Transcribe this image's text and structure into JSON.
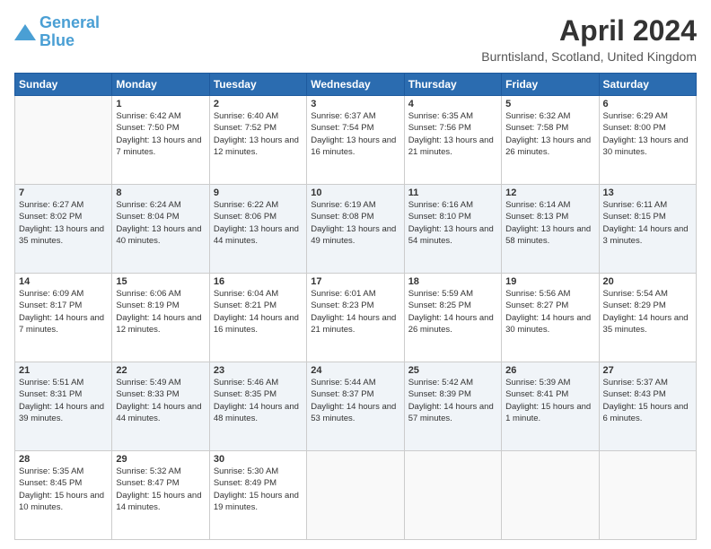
{
  "header": {
    "logo_line1": "General",
    "logo_line2": "Blue",
    "title": "April 2024",
    "subtitle": "Burntisland, Scotland, United Kingdom"
  },
  "days_of_week": [
    "Sunday",
    "Monday",
    "Tuesday",
    "Wednesday",
    "Thursday",
    "Friday",
    "Saturday"
  ],
  "weeks": [
    [
      {
        "num": "",
        "sunrise": "",
        "sunset": "",
        "daylight": ""
      },
      {
        "num": "1",
        "sunrise": "Sunrise: 6:42 AM",
        "sunset": "Sunset: 7:50 PM",
        "daylight": "Daylight: 13 hours and 7 minutes."
      },
      {
        "num": "2",
        "sunrise": "Sunrise: 6:40 AM",
        "sunset": "Sunset: 7:52 PM",
        "daylight": "Daylight: 13 hours and 12 minutes."
      },
      {
        "num": "3",
        "sunrise": "Sunrise: 6:37 AM",
        "sunset": "Sunset: 7:54 PM",
        "daylight": "Daylight: 13 hours and 16 minutes."
      },
      {
        "num": "4",
        "sunrise": "Sunrise: 6:35 AM",
        "sunset": "Sunset: 7:56 PM",
        "daylight": "Daylight: 13 hours and 21 minutes."
      },
      {
        "num": "5",
        "sunrise": "Sunrise: 6:32 AM",
        "sunset": "Sunset: 7:58 PM",
        "daylight": "Daylight: 13 hours and 26 minutes."
      },
      {
        "num": "6",
        "sunrise": "Sunrise: 6:29 AM",
        "sunset": "Sunset: 8:00 PM",
        "daylight": "Daylight: 13 hours and 30 minutes."
      }
    ],
    [
      {
        "num": "7",
        "sunrise": "Sunrise: 6:27 AM",
        "sunset": "Sunset: 8:02 PM",
        "daylight": "Daylight: 13 hours and 35 minutes."
      },
      {
        "num": "8",
        "sunrise": "Sunrise: 6:24 AM",
        "sunset": "Sunset: 8:04 PM",
        "daylight": "Daylight: 13 hours and 40 minutes."
      },
      {
        "num": "9",
        "sunrise": "Sunrise: 6:22 AM",
        "sunset": "Sunset: 8:06 PM",
        "daylight": "Daylight: 13 hours and 44 minutes."
      },
      {
        "num": "10",
        "sunrise": "Sunrise: 6:19 AM",
        "sunset": "Sunset: 8:08 PM",
        "daylight": "Daylight: 13 hours and 49 minutes."
      },
      {
        "num": "11",
        "sunrise": "Sunrise: 6:16 AM",
        "sunset": "Sunset: 8:10 PM",
        "daylight": "Daylight: 13 hours and 54 minutes."
      },
      {
        "num": "12",
        "sunrise": "Sunrise: 6:14 AM",
        "sunset": "Sunset: 8:13 PM",
        "daylight": "Daylight: 13 hours and 58 minutes."
      },
      {
        "num": "13",
        "sunrise": "Sunrise: 6:11 AM",
        "sunset": "Sunset: 8:15 PM",
        "daylight": "Daylight: 14 hours and 3 minutes."
      }
    ],
    [
      {
        "num": "14",
        "sunrise": "Sunrise: 6:09 AM",
        "sunset": "Sunset: 8:17 PM",
        "daylight": "Daylight: 14 hours and 7 minutes."
      },
      {
        "num": "15",
        "sunrise": "Sunrise: 6:06 AM",
        "sunset": "Sunset: 8:19 PM",
        "daylight": "Daylight: 14 hours and 12 minutes."
      },
      {
        "num": "16",
        "sunrise": "Sunrise: 6:04 AM",
        "sunset": "Sunset: 8:21 PM",
        "daylight": "Daylight: 14 hours and 16 minutes."
      },
      {
        "num": "17",
        "sunrise": "Sunrise: 6:01 AM",
        "sunset": "Sunset: 8:23 PM",
        "daylight": "Daylight: 14 hours and 21 minutes."
      },
      {
        "num": "18",
        "sunrise": "Sunrise: 5:59 AM",
        "sunset": "Sunset: 8:25 PM",
        "daylight": "Daylight: 14 hours and 26 minutes."
      },
      {
        "num": "19",
        "sunrise": "Sunrise: 5:56 AM",
        "sunset": "Sunset: 8:27 PM",
        "daylight": "Daylight: 14 hours and 30 minutes."
      },
      {
        "num": "20",
        "sunrise": "Sunrise: 5:54 AM",
        "sunset": "Sunset: 8:29 PM",
        "daylight": "Daylight: 14 hours and 35 minutes."
      }
    ],
    [
      {
        "num": "21",
        "sunrise": "Sunrise: 5:51 AM",
        "sunset": "Sunset: 8:31 PM",
        "daylight": "Daylight: 14 hours and 39 minutes."
      },
      {
        "num": "22",
        "sunrise": "Sunrise: 5:49 AM",
        "sunset": "Sunset: 8:33 PM",
        "daylight": "Daylight: 14 hours and 44 minutes."
      },
      {
        "num": "23",
        "sunrise": "Sunrise: 5:46 AM",
        "sunset": "Sunset: 8:35 PM",
        "daylight": "Daylight: 14 hours and 48 minutes."
      },
      {
        "num": "24",
        "sunrise": "Sunrise: 5:44 AM",
        "sunset": "Sunset: 8:37 PM",
        "daylight": "Daylight: 14 hours and 53 minutes."
      },
      {
        "num": "25",
        "sunrise": "Sunrise: 5:42 AM",
        "sunset": "Sunset: 8:39 PM",
        "daylight": "Daylight: 14 hours and 57 minutes."
      },
      {
        "num": "26",
        "sunrise": "Sunrise: 5:39 AM",
        "sunset": "Sunset: 8:41 PM",
        "daylight": "Daylight: 15 hours and 1 minute."
      },
      {
        "num": "27",
        "sunrise": "Sunrise: 5:37 AM",
        "sunset": "Sunset: 8:43 PM",
        "daylight": "Daylight: 15 hours and 6 minutes."
      }
    ],
    [
      {
        "num": "28",
        "sunrise": "Sunrise: 5:35 AM",
        "sunset": "Sunset: 8:45 PM",
        "daylight": "Daylight: 15 hours and 10 minutes."
      },
      {
        "num": "29",
        "sunrise": "Sunrise: 5:32 AM",
        "sunset": "Sunset: 8:47 PM",
        "daylight": "Daylight: 15 hours and 14 minutes."
      },
      {
        "num": "30",
        "sunrise": "Sunrise: 5:30 AM",
        "sunset": "Sunset: 8:49 PM",
        "daylight": "Daylight: 15 hours and 19 minutes."
      },
      {
        "num": "",
        "sunrise": "",
        "sunset": "",
        "daylight": ""
      },
      {
        "num": "",
        "sunrise": "",
        "sunset": "",
        "daylight": ""
      },
      {
        "num": "",
        "sunrise": "",
        "sunset": "",
        "daylight": ""
      },
      {
        "num": "",
        "sunrise": "",
        "sunset": "",
        "daylight": ""
      }
    ]
  ]
}
